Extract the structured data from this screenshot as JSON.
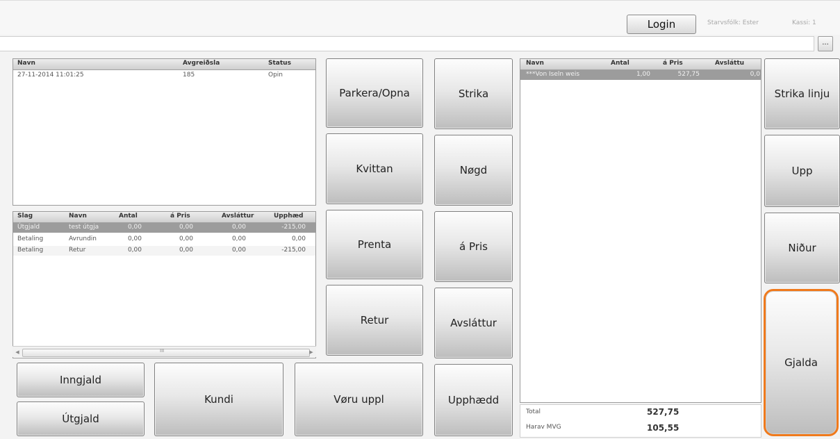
{
  "topbar": {
    "login_label": "Login",
    "staff_text": "Starvsfólk: Ester",
    "register_text": "Kassi: 1",
    "browse_label": "..."
  },
  "barcode_input": {
    "value": "",
    "placeholder": ""
  },
  "sales_grid": {
    "headers": [
      "Navn",
      "Avgreiðsla",
      "Status"
    ],
    "rows": [
      {
        "navn": "27-11-2014 11:01:25",
        "avgreidsla": "185",
        "status": "Opin"
      }
    ]
  },
  "payments_grid": {
    "headers": [
      "Slag",
      "Navn",
      "Antal",
      "á Pris",
      "Avsláttur",
      "Upphæd"
    ],
    "rows": [
      {
        "slag": "Útgjald",
        "navn": "test útgja",
        "antal": "0,00",
        "pris": "0,00",
        "avslattur": "0,00",
        "upphaed": "-215,00"
      },
      {
        "slag": "Betaling",
        "navn": "Avrundin",
        "antal": "0,00",
        "pris": "0,00",
        "avslattur": "0,00",
        "upphaed": "0,00"
      },
      {
        "slag": "Betaling",
        "navn": "Retur",
        "antal": "0,00",
        "pris": "0,00",
        "avslattur": "0,00",
        "upphaed": "-215,00"
      }
    ],
    "scroll_grip": "III"
  },
  "items_grid": {
    "headers": [
      "Navn",
      "Antal",
      "á Pris",
      "Avsláttu"
    ],
    "rows": [
      {
        "navn": "***Von Iseln weis",
        "antal": "1,00",
        "pris": "527,75",
        "avslattur": "0,0"
      }
    ]
  },
  "buttons": {
    "parkera": "Parkera/Opna",
    "strika": "Strika",
    "strika_linju": "Strika linju",
    "kvittan": "Kvittan",
    "nogd": "Nøgd",
    "upp": "Upp",
    "prenta": "Prenta",
    "a_pris": "á Pris",
    "nidur": "Niður",
    "retur": "Retur",
    "avslattur": "Avsláttur",
    "gjalda": "Gjalda",
    "inngjald": "Inngjald",
    "utgjald": "Útgjald",
    "kundi": "Kundi",
    "voru_uppl": "Vøru uppl",
    "upphaedd": "Upphædd"
  },
  "totals": {
    "total_label": "Total",
    "total_value": "527,75",
    "vat_label": "Harav MVG",
    "vat_value": "105,55"
  },
  "colors": {
    "accent_highlight": "#f07a1c",
    "selected_row": "#9c9c9c"
  }
}
